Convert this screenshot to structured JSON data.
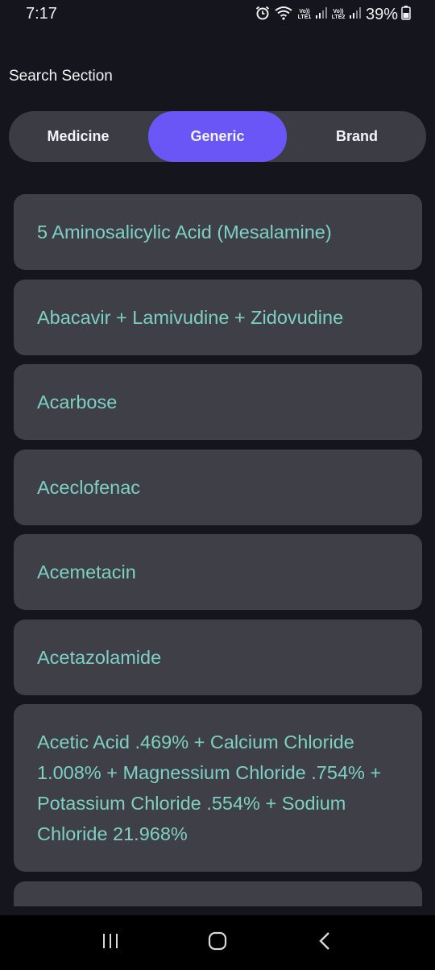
{
  "status_bar": {
    "time": "7:17",
    "battery": "39%",
    "sim1_label_top": "Vo))",
    "sim1_label_bottom": "LTE1",
    "sim2_label_top": "Vo))",
    "sim2_label_bottom": "LTE2",
    "icons": [
      "alarm-icon",
      "wifi-icon",
      "signal-icon",
      "signal-icon",
      "battery-icon"
    ]
  },
  "header": {
    "title": "Search Section"
  },
  "tabs": [
    {
      "label": "Medicine",
      "active": false
    },
    {
      "label": "Generic",
      "active": true
    },
    {
      "label": "Brand",
      "active": false
    }
  ],
  "results": [
    "5 Aminosalicylic Acid (Mesalamine)",
    "Abacavir + Lamivudine + Zidovudine",
    "Acarbose",
    "Aceclofenac",
    "Acemetacin",
    "Acetazolamide",
    "Acetic Acid .469% + Calcium Chloride 1.008% + Magnessium Chloride .754% + Potassium Chloride .554% + Sodium Chloride 21.968%",
    ""
  ],
  "colors": {
    "background": "#14151d",
    "segment_bg": "#3b3c44",
    "active_tab": "#6a55f6",
    "card_bg": "#3e3f47",
    "card_text": "#7fd0c4"
  },
  "navigation": [
    "recent-apps-icon",
    "home-icon",
    "back-icon"
  ]
}
